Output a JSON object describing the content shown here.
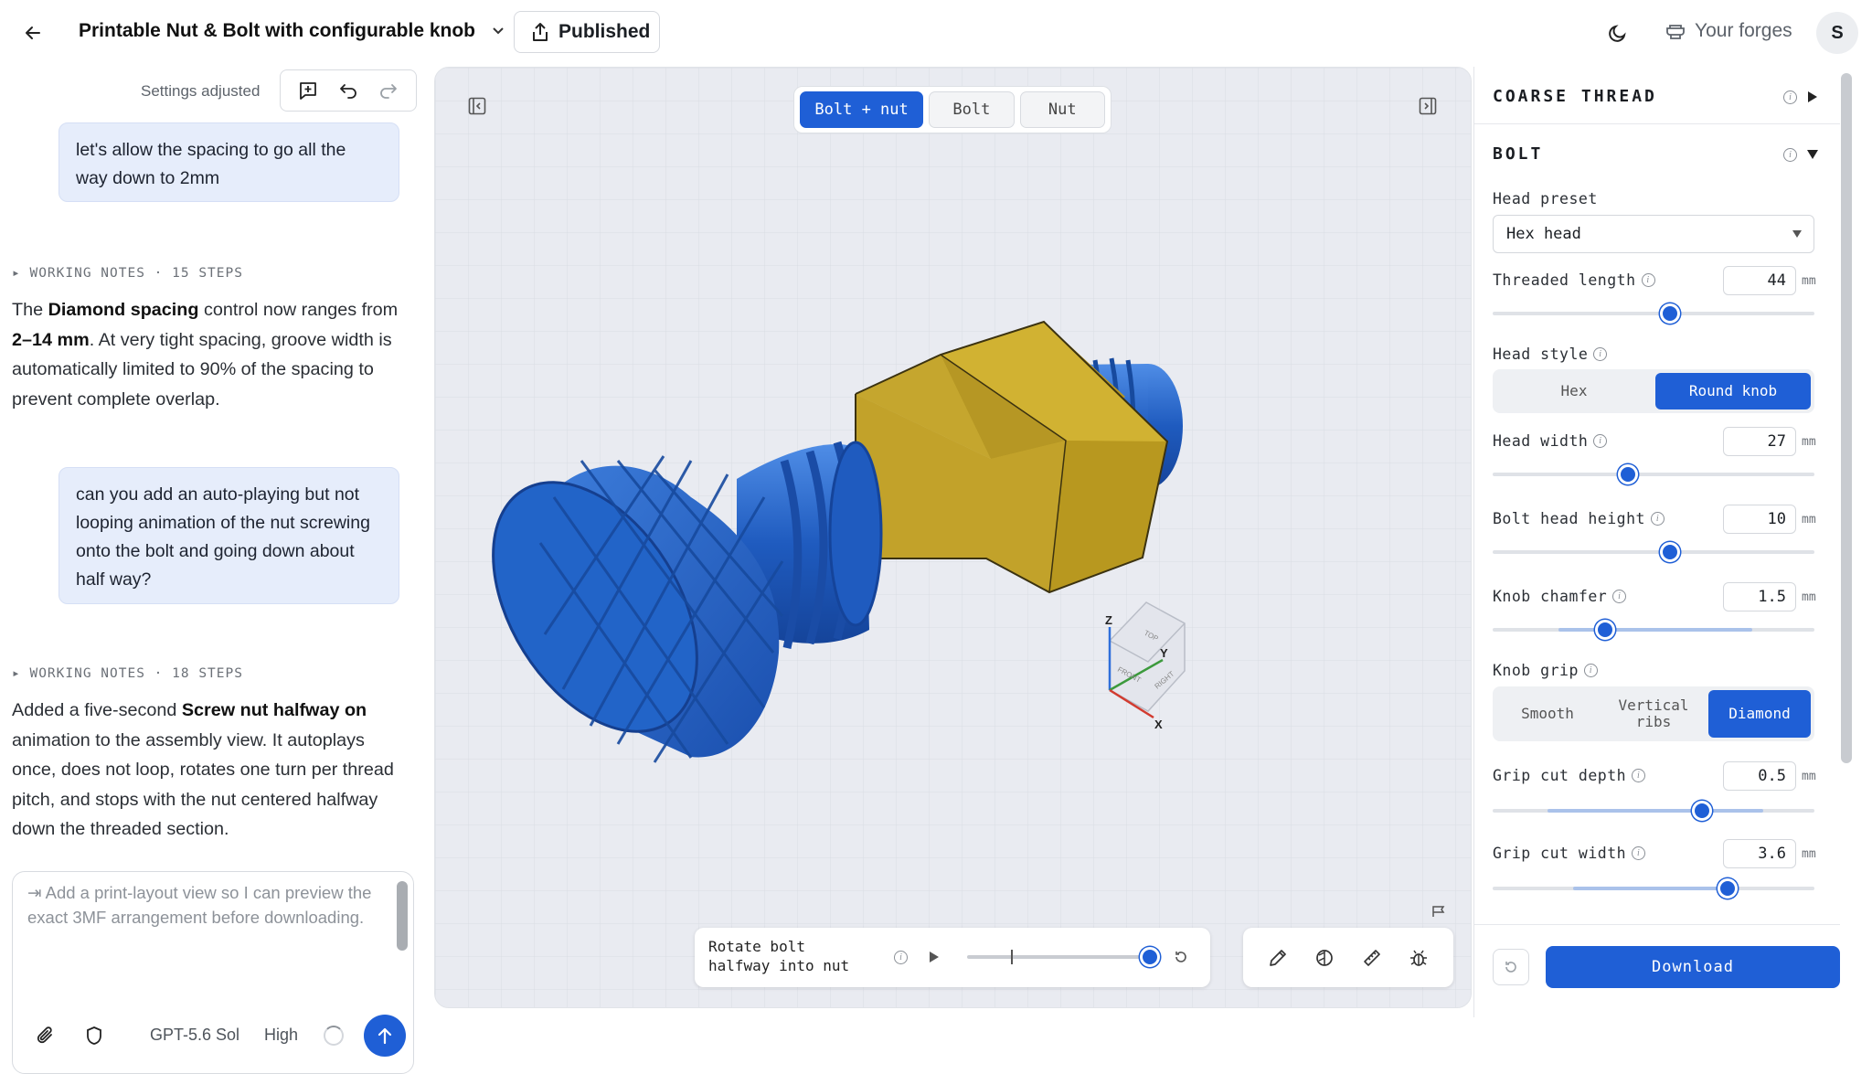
{
  "header": {
    "title": "Printable Nut & Bolt with configurable knob",
    "publish_label": "Published",
    "forges_label": "Your forges",
    "avatar": "S"
  },
  "chat": {
    "status": "Settings adjusted",
    "messages": [
      {
        "role": "user",
        "text": "let's allow the spacing to go all the way down to 2mm"
      },
      {
        "role": "notes",
        "text": "▸ WORKING NOTES · 15 STEPS"
      },
      {
        "role": "assistant",
        "parts": [
          "The ",
          "Diamond spacing",
          " control now ranges from ",
          "2–14 mm",
          ". At very tight spacing, groove width is automatically limited to 90% of the spacing to prevent complete overlap."
        ]
      },
      {
        "role": "user",
        "text": "can you add an auto-playing but not looping animation of the nut screwing onto the bolt and going down about half way?"
      },
      {
        "role": "notes",
        "text": "▸ WORKING NOTES · 18 STEPS"
      },
      {
        "role": "assistant",
        "parts": [
          "Added a five-second ",
          "Screw nut halfway on",
          " animation to the assembly view. It autoplays once, does not loop, rotates one turn per thread pitch, and stops with the nut centered halfway down the threaded section."
        ]
      }
    ],
    "composer": {
      "placeholder": "⇥ Add a print-layout view so I can preview the exact 3MF arrangement before downloading.",
      "model": "GPT-5.6 Sol",
      "effort": "High"
    }
  },
  "viewport": {
    "tabs": [
      {
        "label": "Bolt + nut",
        "active": true
      },
      {
        "label": "Bolt",
        "active": false
      },
      {
        "label": "Nut",
        "active": false
      }
    ],
    "animation": {
      "label": "Rotate bolt halfway into nut",
      "progress": 1.0
    },
    "axes": {
      "z": "Z",
      "y": "Y",
      "x": "X",
      "top": "TOP",
      "front": "FRONT",
      "right": "RIGHT"
    },
    "colors": {
      "bolt": "#1f5bbf",
      "nut": "#c9a92b",
      "accent": "#1f5fd6"
    }
  },
  "panel": {
    "sections": [
      {
        "title": "COARSE THREAD",
        "expanded": false
      },
      {
        "title": "BOLT",
        "expanded": true
      }
    ],
    "head_preset": {
      "label": "Head preset",
      "value": "Hex head"
    },
    "threaded_length": {
      "label": "Threaded length",
      "value": "44",
      "unit": "mm",
      "pos": 0.55
    },
    "head_style": {
      "label": "Head style",
      "options": [
        "Hex",
        "Round knob"
      ],
      "selected": "Round knob"
    },
    "head_width": {
      "label": "Head width",
      "value": "27",
      "unit": "mm",
      "pos": 0.42
    },
    "bolt_head_height": {
      "label": "Bolt head height",
      "value": "10",
      "unit": "mm",
      "pos": 0.55
    },
    "knob_chamfer": {
      "label": "Knob chamfer",
      "value": "1.5",
      "unit": "mm",
      "pos": 0.35
    },
    "knob_grip": {
      "label": "Knob grip",
      "options": [
        "Smooth",
        "Vertical ribs",
        "Diamond"
      ],
      "selected": "Diamond"
    },
    "grip_cut_depth": {
      "label": "Grip cut depth",
      "value": "0.5",
      "unit": "mm",
      "pos": 0.65
    },
    "grip_cut_width": {
      "label": "Grip cut width",
      "value": "3.6",
      "unit": "mm",
      "pos": 0.73
    },
    "download_label": "Download"
  }
}
